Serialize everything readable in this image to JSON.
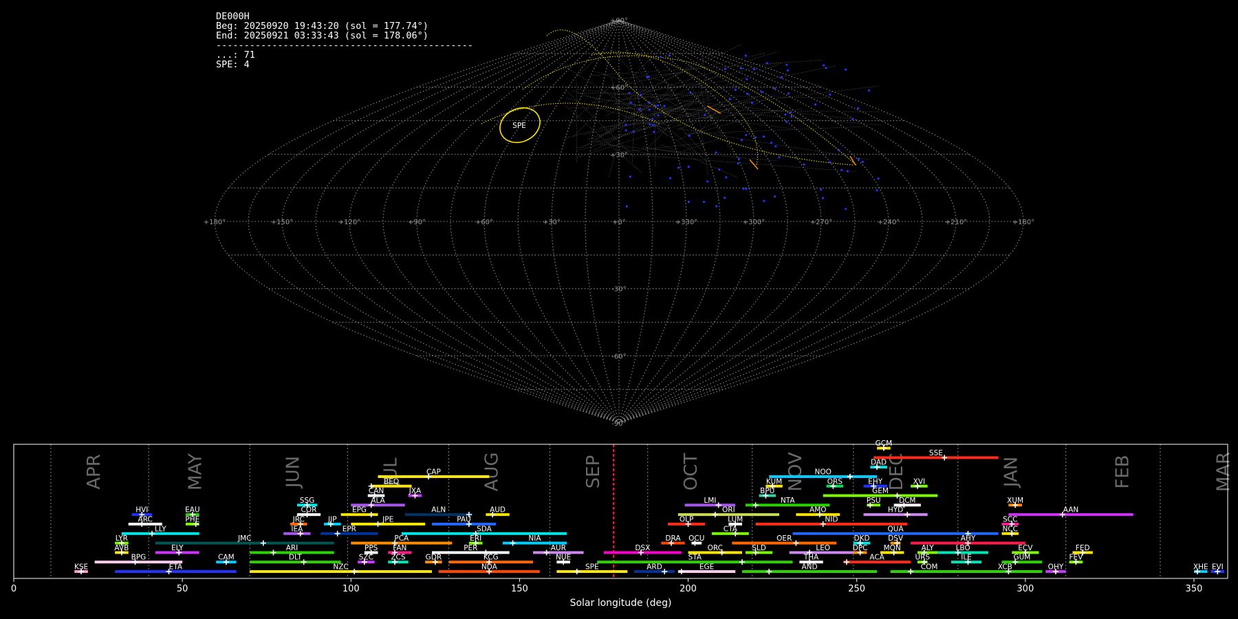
{
  "info": {
    "station": "DE000H",
    "beg": "Beg: 20250920 19:43:20 (sol = 177.74°)",
    "end": "End: 20250921 03:33:43 (sol = 178.06°)",
    "rule": "----------------------------------------------",
    "lines": [
      "...: 71",
      "SPE: 4"
    ]
  },
  "sky_map": {
    "projection": "sinusoidal",
    "lon_labels": [
      "+180°",
      "+150°",
      "+120°",
      "+90°",
      "+60°",
      "+30°",
      "+0°",
      "+330°",
      "+300°",
      "+270°",
      "+240°",
      "+210°",
      "+180°"
    ],
    "lat_labels": [
      "+90°",
      "+60°",
      "+30°",
      "-30°",
      "-60°",
      "-90°"
    ],
    "shower_label": "SPE",
    "colors": {
      "grid": "#8c8c8c",
      "highlight": "#ffe600",
      "dots": "#2233ff"
    }
  },
  "chart_data": {
    "type": "timeline",
    "xlabel": "Solar longitude (deg)",
    "xlim": [
      0,
      360
    ],
    "xticks": [
      0,
      50,
      100,
      150,
      200,
      250,
      300,
      350
    ],
    "current_sol": 177.9,
    "months": [
      {
        "label": "APR",
        "sol": 24
      },
      {
        "label": "MAY",
        "sol": 54
      },
      {
        "label": "JUN",
        "sol": 83
      },
      {
        "label": "JUL",
        "sol": 112
      },
      {
        "label": "AUG",
        "sol": 142
      },
      {
        "label": "SEP",
        "sol": 172
      },
      {
        "label": "OCT",
        "sol": 201
      },
      {
        "label": "NOV",
        "sol": 232
      },
      {
        "label": "DEC",
        "sol": 262
      },
      {
        "label": "JAN",
        "sol": 296
      },
      {
        "label": "FEB",
        "sol": 329
      },
      {
        "label": "MAR",
        "sol": 359
      }
    ],
    "month_boundaries": [
      11,
      40,
      70,
      99,
      129,
      159,
      188,
      219,
      249,
      280,
      312,
      340
    ],
    "showers": [
      {
        "code": "GCM",
        "start": 256,
        "end": 260,
        "peak": 258,
        "row": 14,
        "color": "#ffe600"
      },
      {
        "code": "SSE",
        "start": 255,
        "end": 292,
        "peak": 276,
        "row": 13,
        "color": "#ff2a1a"
      },
      {
        "code": "CAP",
        "start": 108,
        "end": 141,
        "peak": 123,
        "row": 11,
        "color": "#ffe600"
      },
      {
        "code": "DAD",
        "start": 254,
        "end": 259,
        "peak": 256,
        "row": 12,
        "color": "#00e5e5"
      },
      {
        "code": "NOO",
        "start": 224,
        "end": 256,
        "peak": 248,
        "row": 11,
        "color": "#00ccff"
      },
      {
        "code": "BEQ",
        "start": 106,
        "end": 118,
        "peak": 106,
        "row": 10,
        "color": "#ffe600"
      },
      {
        "code": "KUM",
        "start": 223,
        "end": 228,
        "peak": 225,
        "row": 10,
        "color": "#ffe600"
      },
      {
        "code": "ORS",
        "start": 241,
        "end": 246,
        "peak": 243,
        "row": 10,
        "color": "#00dd55"
      },
      {
        "code": "EHY",
        "start": 252,
        "end": 259,
        "peak": 255,
        "row": 10,
        "color": "#2233ff"
      },
      {
        "code": "XVI",
        "start": 266,
        "end": 271,
        "peak": 268,
        "row": 10,
        "color": "#7cfc00"
      },
      {
        "code": "CAN",
        "start": 105,
        "end": 110,
        "peak": 107,
        "row": 9,
        "color": "#ffffff"
      },
      {
        "code": "JXA",
        "start": 117,
        "end": 121,
        "peak": 119,
        "row": 9,
        "color": "#cc33ff"
      },
      {
        "code": "BPU",
        "start": 221,
        "end": 226,
        "peak": 223,
        "row": 9,
        "color": "#2ad4a8"
      },
      {
        "code": "GEM",
        "start": 240,
        "end": 274,
        "peak": 262,
        "row": 9,
        "color": "#7cfc00"
      },
      {
        "code": "HVI",
        "start": 35,
        "end": 41,
        "peak": 38,
        "row": 7,
        "color": "#2233ff"
      },
      {
        "code": "EAU",
        "start": 51,
        "end": 55,
        "peak": 53,
        "row": 7,
        "color": "#2ad400"
      },
      {
        "code": "SSG",
        "start": 84,
        "end": 90,
        "peak": 87,
        "row": 8,
        "color": "#00e5e5"
      },
      {
        "code": "ALA",
        "start": 100,
        "end": 116,
        "peak": 106,
        "row": 8,
        "color": "#aa55ee"
      },
      {
        "code": "LMI",
        "start": 199,
        "end": 214,
        "peak": 209,
        "row": 8,
        "color": "#aa55ee"
      },
      {
        "code": "NTA",
        "start": 217,
        "end": 242,
        "peak": 220,
        "row": 8,
        "color": "#2ad400"
      },
      {
        "code": "PSU",
        "start": 253,
        "end": 257,
        "peak": 254,
        "row": 8,
        "color": "#7cfc00"
      },
      {
        "code": "DCM",
        "start": 261,
        "end": 269,
        "peak": 264,
        "row": 8,
        "color": "#ffffff"
      },
      {
        "code": "XUM",
        "start": 295,
        "end": 299,
        "peak": 297,
        "row": 8,
        "color": "#ff8c00"
      },
      {
        "code": "COR",
        "start": 84,
        "end": 91,
        "peak": 87,
        "row": 7,
        "color": "#ffffff"
      },
      {
        "code": "EPG",
        "start": 97,
        "end": 108,
        "peak": 106,
        "row": 7,
        "color": "#ffe600"
      },
      {
        "code": "ALN",
        "start": 116,
        "end": 136,
        "peak": 135,
        "row": 7,
        "color": "#003366"
      },
      {
        "code": "AUD",
        "start": 140,
        "end": 147,
        "peak": 142,
        "row": 7,
        "color": "#ffe600"
      },
      {
        "code": "ORI",
        "start": 197,
        "end": 227,
        "peak": 208,
        "row": 7,
        "color": "#ccdd55"
      },
      {
        "code": "AMO",
        "start": 232,
        "end": 245,
        "peak": 239,
        "row": 7,
        "color": "#ffe600"
      },
      {
        "code": "HYD",
        "start": 252,
        "end": 271,
        "peak": 265,
        "row": 7,
        "color": "#cc88ee"
      },
      {
        "code": "AAN",
        "start": 295,
        "end": 332,
        "peak": 311,
        "row": 7,
        "color": "#cc33ff"
      },
      {
        "code": "ARC",
        "start": 34,
        "end": 44,
        "peak": 38,
        "row": 6,
        "color": "#ffffff"
      },
      {
        "code": "PHE",
        "start": 51,
        "end": 55,
        "peak": 54,
        "row": 6,
        "color": "#7cfc00"
      },
      {
        "code": "JRC",
        "start": 82,
        "end": 87,
        "peak": 85,
        "row": 6,
        "color": "#ff6600"
      },
      {
        "code": "JIP",
        "start": 92,
        "end": 97,
        "peak": 94,
        "row": 6,
        "color": "#00ccff"
      },
      {
        "code": "JPE",
        "start": 100,
        "end": 122,
        "peak": 108,
        "row": 6,
        "color": "#ffe600"
      },
      {
        "code": "PAU",
        "start": 124,
        "end": 143,
        "peak": 135,
        "row": 6,
        "color": "#2266ff"
      },
      {
        "code": "OLP",
        "start": 194,
        "end": 205,
        "peak": 200,
        "row": 6,
        "color": "#ff2a1a"
      },
      {
        "code": "LUM",
        "start": 212,
        "end": 216,
        "peak": 214,
        "row": 6,
        "color": "#ffffff"
      },
      {
        "code": "NID",
        "start": 220,
        "end": 265,
        "peak": 240,
        "row": 6,
        "color": "#ff2a1a"
      },
      {
        "code": "SCC",
        "start": 293,
        "end": 298,
        "peak": 296,
        "row": 6,
        "color": "#ff1a8c"
      },
      {
        "code": "LLY",
        "start": 32,
        "end": 55,
        "peak": 41,
        "row": 5,
        "color": "#00e5e5"
      },
      {
        "code": "IEA",
        "start": 80,
        "end": 88,
        "peak": 85,
        "row": 5,
        "color": "#aa55ee"
      },
      {
        "code": "EPR",
        "start": 91,
        "end": 108,
        "peak": 96,
        "row": 5,
        "color": "#003399"
      },
      {
        "code": "SDA",
        "start": 115,
        "end": 164,
        "peak": 137,
        "row": 5,
        "color": "#00e5e5"
      },
      {
        "code": "CTA",
        "start": 207,
        "end": 218,
        "peak": 214,
        "row": 5,
        "color": "#7cfc00"
      },
      {
        "code": "QUA",
        "start": 231,
        "end": 292,
        "peak": 283,
        "row": 5,
        "color": "#2266ff"
      },
      {
        "code": "NCC",
        "start": 293,
        "end": 298,
        "peak": 296,
        "row": 5,
        "color": "#ffe600"
      },
      {
        "code": "LYR",
        "start": 30,
        "end": 34,
        "peak": 32,
        "row": 4,
        "color": "#7cfc00"
      },
      {
        "code": "JMC",
        "start": 42,
        "end": 95,
        "peak": 74,
        "row": 4,
        "color": "#005555"
      },
      {
        "code": "PCA",
        "start": 100,
        "end": 130,
        "peak": 113,
        "row": 4,
        "color": "#ff8c00"
      },
      {
        "code": "ERI",
        "start": 135,
        "end": 139,
        "peak": 137,
        "row": 4,
        "color": "#7cfc00"
      },
      {
        "code": "NIA",
        "start": 145,
        "end": 164,
        "peak": 148,
        "row": 4,
        "color": "#00ccff"
      },
      {
        "code": "DRA",
        "start": 192,
        "end": 199,
        "peak": 195,
        "row": 4,
        "color": "#ff4400"
      },
      {
        "code": "OCU",
        "start": 201,
        "end": 204,
        "peak": 202,
        "row": 4,
        "color": "#ffffff"
      },
      {
        "code": "OER",
        "start": 213,
        "end": 244,
        "peak": 232,
        "row": 4,
        "color": "#ff6600"
      },
      {
        "code": "DKD",
        "start": 249,
        "end": 254,
        "peak": 251,
        "row": 4,
        "color": "#00e5e5"
      },
      {
        "code": "DSV",
        "start": 260,
        "end": 263,
        "peak": 262,
        "row": 4,
        "color": "#ff8c00"
      },
      {
        "code": "AHY",
        "start": 266,
        "end": 300,
        "peak": 283,
        "row": 4,
        "color": "#ff1a4a"
      },
      {
        "code": "AVB",
        "start": 30,
        "end": 34,
        "peak": 32,
        "row": 3,
        "color": "#ffe600"
      },
      {
        "code": "ELY",
        "start": 42,
        "end": 55,
        "peak": 49,
        "row": 3,
        "color": "#cc33ff"
      },
      {
        "code": "ARI",
        "start": 70,
        "end": 95,
        "peak": 77,
        "row": 3,
        "color": "#2ad400"
      },
      {
        "code": "PPS",
        "start": 104,
        "end": 108,
        "peak": 106,
        "row": 3,
        "color": "#ffffff"
      },
      {
        "code": "FAN",
        "start": 111,
        "end": 118,
        "peak": 113,
        "row": 3,
        "color": "#ff1a8c"
      },
      {
        "code": "PER",
        "start": 124,
        "end": 147,
        "peak": 140,
        "row": 3,
        "color": "#ffffff"
      },
      {
        "code": "AUR",
        "start": 154,
        "end": 169,
        "peak": 158,
        "row": 3,
        "color": "#cc88ee"
      },
      {
        "code": "DSX",
        "start": 175,
        "end": 198,
        "peak": 186,
        "row": 3,
        "color": "#ff00cc"
      },
      {
        "code": "ORC",
        "start": 200,
        "end": 216,
        "peak": 210,
        "row": 3,
        "color": "#ffe600"
      },
      {
        "code": "SLD",
        "start": 217,
        "end": 225,
        "peak": 220,
        "row": 3,
        "color": "#7cfc00"
      },
      {
        "code": "LEO",
        "start": 230,
        "end": 250,
        "peak": 236,
        "row": 3,
        "color": "#cc88ee"
      },
      {
        "code": "DPC",
        "start": 249,
        "end": 253,
        "peak": 251,
        "row": 3,
        "color": "#ff8c00"
      },
      {
        "code": "MON",
        "start": 257,
        "end": 264,
        "peak": 261,
        "row": 3,
        "color": "#ffe600"
      },
      {
        "code": "ALY",
        "start": 268,
        "end": 274,
        "peak": 270,
        "row": 3,
        "color": "#7cfc00"
      },
      {
        "code": "LBO",
        "start": 274,
        "end": 289,
        "peak": 280,
        "row": 3,
        "color": "#00e5b8"
      },
      {
        "code": "ECV",
        "start": 296,
        "end": 304,
        "peak": 300,
        "row": 3,
        "color": "#7cfc00"
      },
      {
        "code": "FED",
        "start": 314,
        "end": 320,
        "peak": 317,
        "row": 3,
        "color": "#ffe600"
      },
      {
        "code": "BPG",
        "start": 24,
        "end": 50,
        "peak": 36,
        "row": 2,
        "color": "#ffccee"
      },
      {
        "code": "CAM",
        "start": 60,
        "end": 66,
        "peak": 63,
        "row": 2,
        "color": "#00ccff"
      },
      {
        "code": "DLT",
        "start": 70,
        "end": 97,
        "peak": 86,
        "row": 2,
        "color": "#2ad400"
      },
      {
        "code": "SZC",
        "start": 102,
        "end": 107,
        "peak": 104,
        "row": 2,
        "color": "#cc33ff"
      },
      {
        "code": "ZCS",
        "start": 111,
        "end": 117,
        "peak": 113,
        "row": 2,
        "color": "#00e5b8"
      },
      {
        "code": "GDR",
        "start": 122,
        "end": 127,
        "peak": 125,
        "row": 2,
        "color": "#ff8c00"
      },
      {
        "code": "KCG",
        "start": 129,
        "end": 154,
        "peak": 141,
        "row": 2,
        "color": "#ff6600"
      },
      {
        "code": "NUE",
        "start": 161,
        "end": 165,
        "peak": 163,
        "row": 2,
        "color": "#ffffff"
      },
      {
        "code": "STA",
        "start": 173,
        "end": 231,
        "peak": 216,
        "row": 2,
        "color": "#2ad400"
      },
      {
        "code": "THA",
        "start": 233,
        "end": 240,
        "peak": 236,
        "row": 2,
        "color": "#ffffff"
      },
      {
        "code": "ACA",
        "start": 246,
        "end": 266,
        "peak": 247,
        "row": 2,
        "color": "#ff2a1a"
      },
      {
        "code": "URS",
        "start": 268,
        "end": 271,
        "peak": 270,
        "row": 2,
        "color": "#7cfc00"
      },
      {
        "code": "ILE",
        "start": 278,
        "end": 287,
        "peak": 283,
        "row": 2,
        "color": "#00e5b8"
      },
      {
        "code": "GUM",
        "start": 293,
        "end": 305,
        "peak": 297,
        "row": 2,
        "color": "#2ad400"
      },
      {
        "code": "FEV",
        "start": 313,
        "end": 317,
        "peak": 315,
        "row": 2,
        "color": "#7cfc00"
      },
      {
        "code": "KSE",
        "start": 18,
        "end": 22,
        "peak": 20,
        "row": 1,
        "color": "#ff99cc"
      },
      {
        "code": "ETA",
        "start": 30,
        "end": 66,
        "peak": 46,
        "row": 1,
        "color": "#2233ff"
      },
      {
        "code": "NZC",
        "start": 70,
        "end": 124,
        "peak": 101,
        "row": 1,
        "color": "#ffe600"
      },
      {
        "code": "NDA",
        "start": 126,
        "end": 156,
        "peak": 141,
        "row": 1,
        "color": "#ff4400"
      },
      {
        "code": "SPE",
        "start": 161,
        "end": 182,
        "peak": 167,
        "row": 1,
        "color": "#ffe600"
      },
      {
        "code": "ARD",
        "start": 184,
        "end": 196,
        "peak": 193,
        "row": 1,
        "color": "#003399"
      },
      {
        "code": "EGE",
        "start": 197,
        "end": 214,
        "peak": 198,
        "row": 1,
        "color": "#ffccee"
      },
      {
        "code": "AND",
        "start": 216,
        "end": 256,
        "peak": 224,
        "row": 1,
        "color": "#2ad400"
      },
      {
        "code": "COM",
        "start": 260,
        "end": 283,
        "peak": 266,
        "row": 1,
        "color": "#2ad400"
      },
      {
        "code": "XCB",
        "start": 283,
        "end": 305,
        "peak": 295,
        "row": 1,
        "color": "#2ad400"
      },
      {
        "code": "OHY",
        "start": 306,
        "end": 312,
        "peak": 309,
        "row": 1,
        "color": "#cc33ff"
      },
      {
        "code": "XHE",
        "start": 350,
        "end": 354,
        "peak": 351,
        "row": 1,
        "color": "#00ccff"
      },
      {
        "code": "EVI",
        "start": 355,
        "end": 359,
        "peak": 357,
        "row": 1,
        "color": "#2233ff"
      }
    ]
  }
}
